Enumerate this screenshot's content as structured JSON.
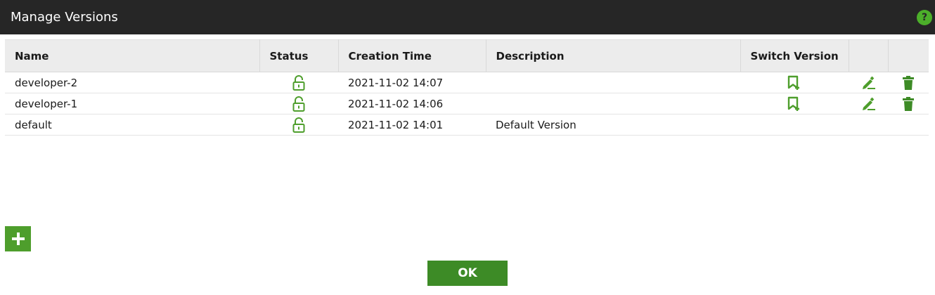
{
  "dialog": {
    "title": "Manage Versions",
    "help_icon": "question-circle-icon",
    "help_label": "?"
  },
  "table": {
    "columns": {
      "name": "Name",
      "status": "Status",
      "creation_time": "Creation Time",
      "description": "Description",
      "switch_version": "Switch Version"
    },
    "rows": [
      {
        "name": "developer-2",
        "status_icon": "unlocked-padlock-icon",
        "creation_time": "2021-11-02 14:07",
        "description": "",
        "switchable": true,
        "editable": true,
        "deletable": true
      },
      {
        "name": "developer-1",
        "status_icon": "unlocked-padlock-icon",
        "creation_time": "2021-11-02 14:06",
        "description": "",
        "switchable": true,
        "editable": true,
        "deletable": true
      },
      {
        "name": "default",
        "status_icon": "unlocked-padlock-icon",
        "creation_time": "2021-11-02 14:01",
        "description": "Default Version",
        "switchable": false,
        "editable": false,
        "deletable": false
      }
    ]
  },
  "buttons": {
    "add_icon": "plus-icon",
    "ok": "OK"
  },
  "colors": {
    "titlebar": "#262626",
    "accent_green": "#4e9e2c",
    "ok_green": "#3d8b26",
    "header_bg": "#ececec"
  }
}
